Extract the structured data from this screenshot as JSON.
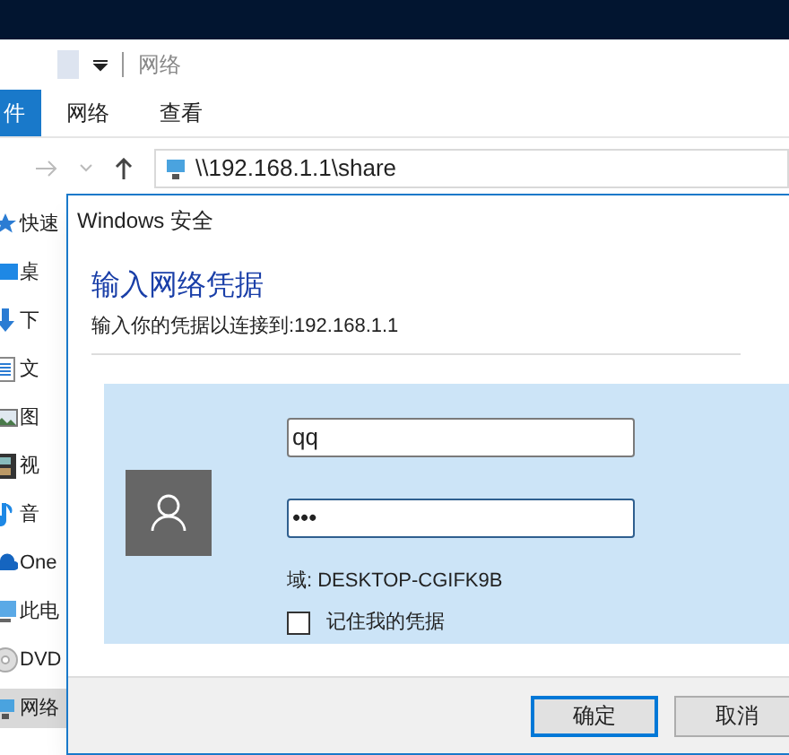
{
  "explorer": {
    "quick_access_title": "网络",
    "ribbon_tabs": [
      {
        "label": "件",
        "selected": true
      },
      {
        "label": "网络",
        "selected": false
      },
      {
        "label": "查看",
        "selected": false
      }
    ],
    "address": "\\\\192.168.1.1\\share",
    "nav_items": [
      {
        "label": "快速",
        "kind": "star",
        "selected": false
      },
      {
        "label": "桌",
        "kind": "desktop",
        "selected": false
      },
      {
        "label": "下",
        "kind": "download",
        "selected": false
      },
      {
        "label": "文",
        "kind": "document",
        "selected": false
      },
      {
        "label": "图",
        "kind": "picture",
        "selected": false
      },
      {
        "label": "视",
        "kind": "video",
        "selected": false
      },
      {
        "label": "音",
        "kind": "music",
        "selected": false
      },
      {
        "label": "One",
        "kind": "cloud",
        "selected": false
      },
      {
        "label": "此电",
        "kind": "computer",
        "selected": false
      },
      {
        "label": "DVD",
        "kind": "disc",
        "selected": false
      },
      {
        "label": "网络",
        "kind": "network",
        "selected": true
      }
    ]
  },
  "dialog": {
    "title": "Windows 安全",
    "heading": "输入网络凭据",
    "subtitle": "输入你的凭据以连接到:192.168.1.1",
    "username": "qq",
    "password": "•••",
    "domain": "域: DESKTOP-CGIFK9B",
    "remember": {
      "label": "记住我的凭据",
      "checked": false
    },
    "buttons": [
      {
        "label": "确定",
        "selected": true
      },
      {
        "label": "取消",
        "selected": false
      }
    ]
  }
}
